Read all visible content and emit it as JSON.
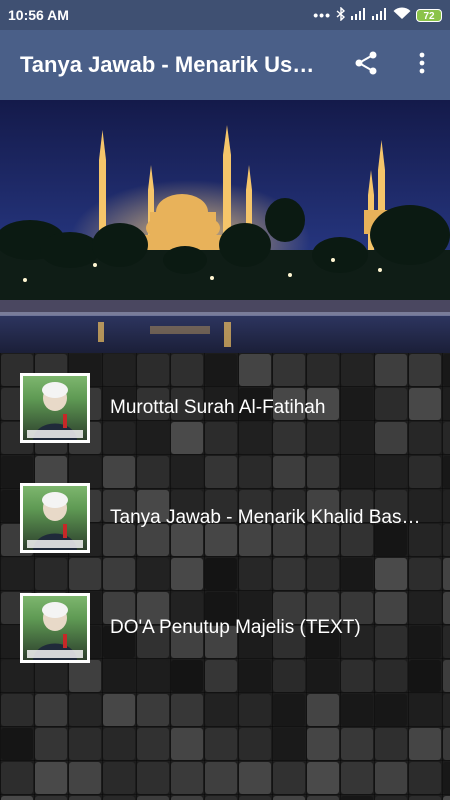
{
  "status": {
    "time": "10:56 AM",
    "dots": "•••",
    "battery": "72"
  },
  "app_bar": {
    "title": "Tanya Jawab - Menarik Ustadz Khalid Basalamah",
    "icons": [
      "share-icon",
      "more-vert-icon"
    ]
  },
  "list": {
    "items": [
      {
        "label": "Murottal Surah Al-Fatihah"
      },
      {
        "label": "Tanya Jawab - Menarik Khalid Basalamah"
      },
      {
        "label": "DO'A Penutup Majelis (TEXT)"
      }
    ]
  },
  "colors": {
    "status_bar": "#3f5072",
    "app_bar": "#4a5f88",
    "battery": "#8bc34a"
  }
}
